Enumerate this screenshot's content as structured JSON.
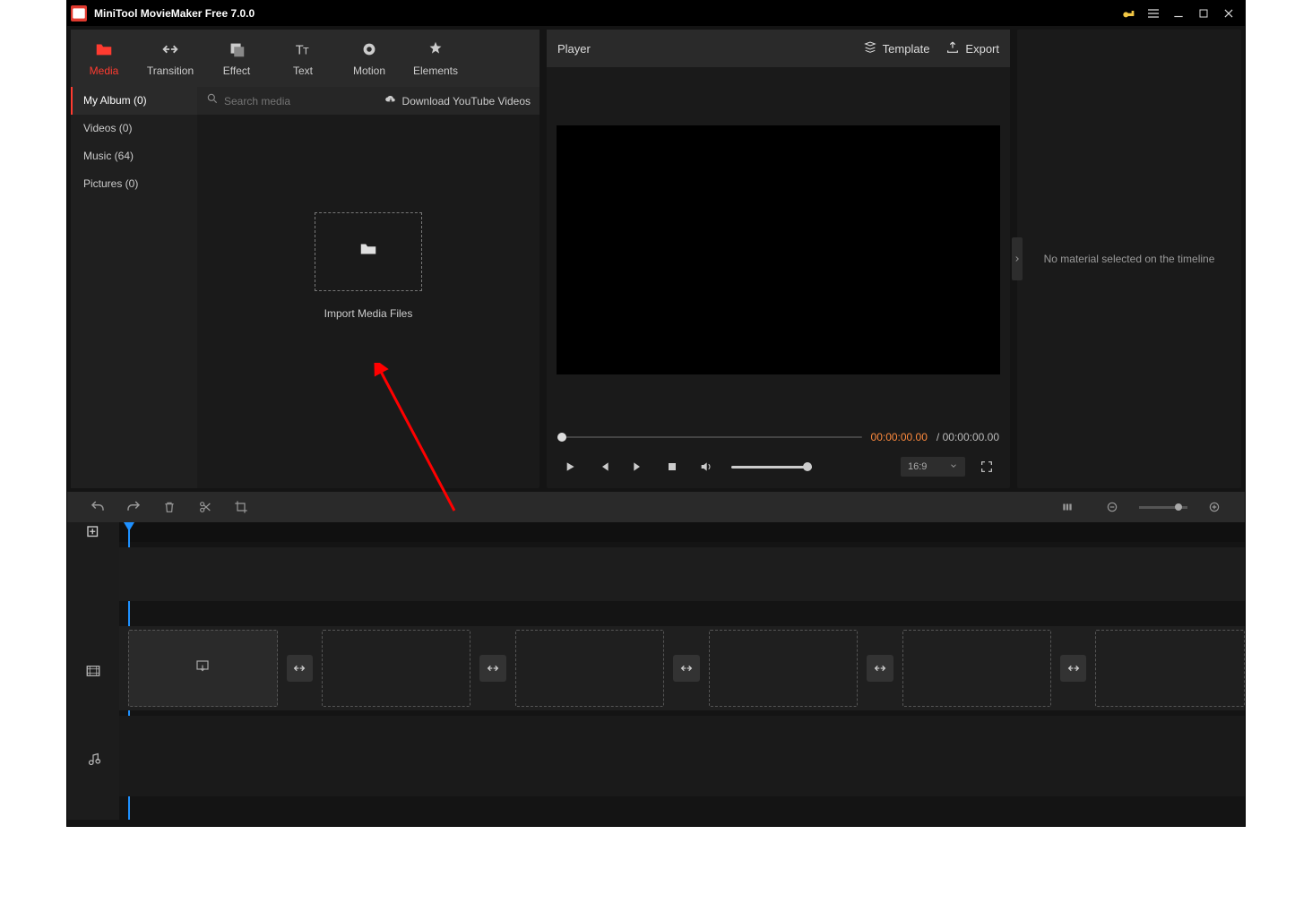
{
  "title": "MiniTool MovieMaker Free 7.0.0",
  "asset_tabs": {
    "media": "Media",
    "transition": "Transition",
    "effect": "Effect",
    "text": "Text",
    "motion": "Motion",
    "elements": "Elements"
  },
  "media_sidebar": {
    "items": [
      {
        "label": "My Album (0)"
      },
      {
        "label": "Videos (0)"
      },
      {
        "label": "Music (64)"
      },
      {
        "label": "Pictures (0)"
      }
    ]
  },
  "search": {
    "placeholder": "Search media"
  },
  "download_link": "Download YouTube Videos",
  "import_label": "Import Media Files",
  "player": {
    "title": "Player",
    "template": "Template",
    "export": "Export",
    "time_current": "00:00:00.00",
    "time_total_prefix": "/ ",
    "time_total": "00:00:00.00",
    "ratio": "16:9"
  },
  "props": {
    "empty_message": "No material selected on the timeline"
  }
}
